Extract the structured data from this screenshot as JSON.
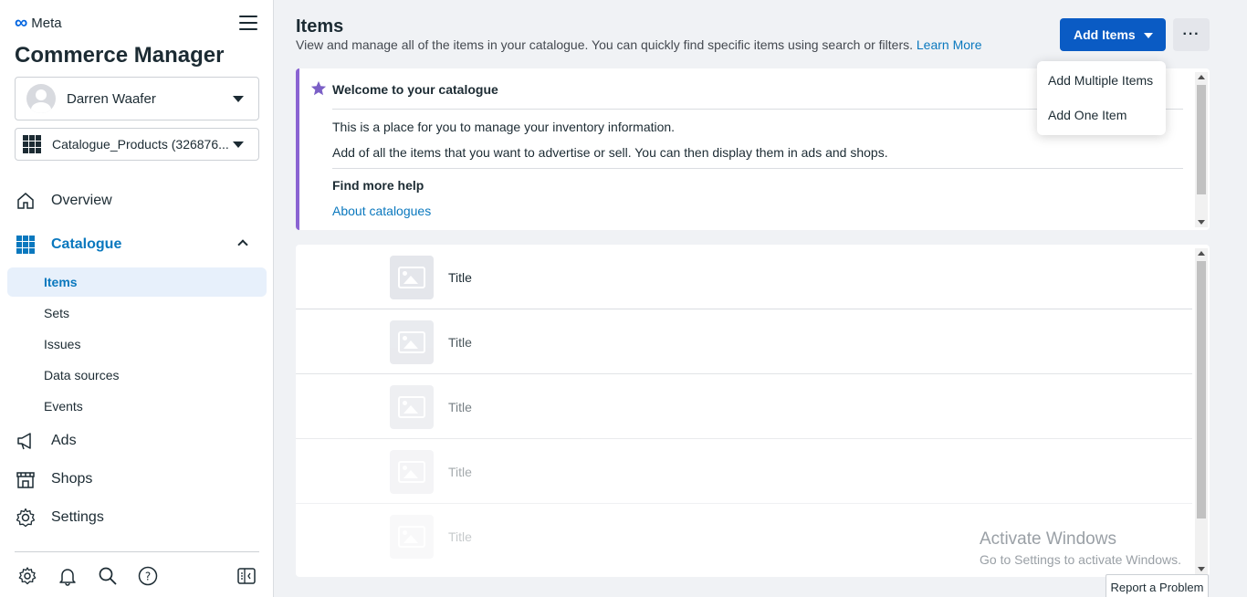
{
  "brand": {
    "logo_text": "Meta",
    "app_title": "Commerce Manager"
  },
  "account": {
    "user_name": "Darren Waafer",
    "catalogue_name": "Catalogue_Products (326876..."
  },
  "nav": {
    "overview": "Overview",
    "catalogue": "Catalogue",
    "catalogue_items": [
      "Items",
      "Sets",
      "Issues",
      "Data sources",
      "Events"
    ],
    "ads": "Ads",
    "shops": "Shops",
    "settings": "Settings"
  },
  "bottom_icons": [
    "settings-gear-icon",
    "notifications-bell-icon",
    "search-icon",
    "help-icon",
    "panel-toggle-icon"
  ],
  "page": {
    "title": "Items",
    "description": "View and manage all of the items in your catalogue. You can quickly find specific items using search or filters.",
    "learn_more": "Learn More",
    "add_items_label": "Add Items",
    "more_label": "···"
  },
  "dropdown": {
    "options": [
      "Add Multiple Items",
      "Add One Item"
    ]
  },
  "welcome": {
    "title": "Welcome to your catalogue",
    "line1": "This is a place for you to manage your inventory information.",
    "line2": "Add of all the items that you want to advertise or sell. You can then display them in ads and shops.",
    "help_title": "Find more help",
    "help_link": "About catalogues"
  },
  "items": [
    {
      "title": "Title",
      "opacity": 1.0
    },
    {
      "title": "Title",
      "opacity": 0.8
    },
    {
      "title": "Title",
      "opacity": 0.6
    },
    {
      "title": "Title",
      "opacity": 0.4
    },
    {
      "title": "Title",
      "opacity": 0.25
    }
  ],
  "watermark": {
    "line1": "Activate Windows",
    "line2": "Go to Settings to activate Windows."
  },
  "report_problem": "Report a Problem",
  "colors": {
    "primary": "#0a5bc4",
    "link": "#0a78be",
    "accent_purple": "#8a63d2",
    "selected_bg": "#e7f0fb"
  }
}
